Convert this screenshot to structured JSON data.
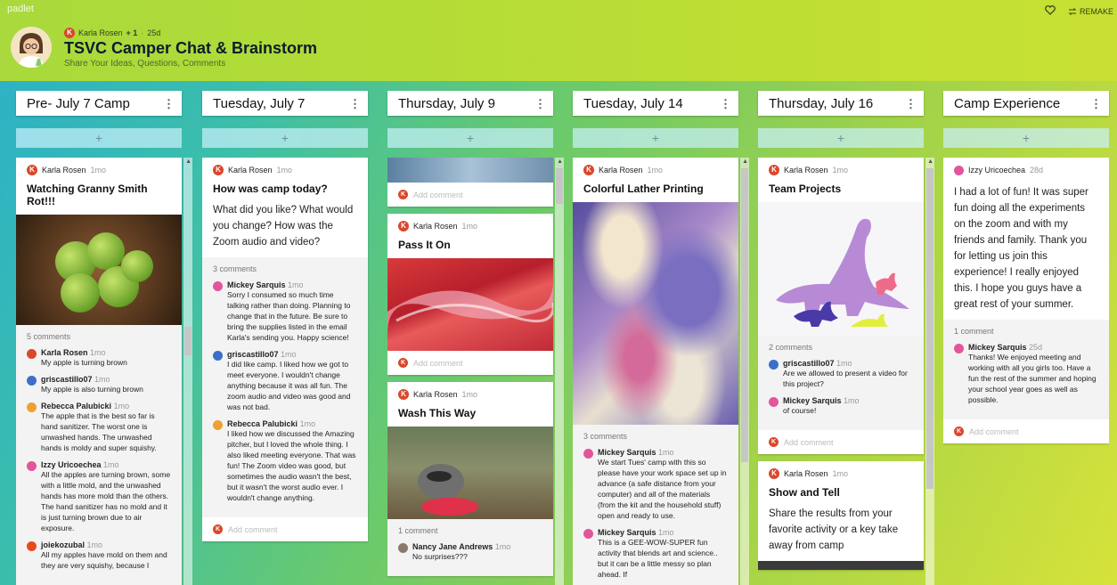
{
  "app": {
    "brand": "padlet",
    "remake_label": "REMAKE"
  },
  "board": {
    "author": "Karla Rosen",
    "plus_count": "+ 1",
    "age": "25d",
    "title": "TSVC Camper Chat & Brainstorm",
    "subtitle": "Share Your Ideas, Questions, Comments"
  },
  "icons": {
    "like": "heart-icon",
    "remake": "remake-icon",
    "more": "kebab-icon",
    "add": "plus-icon"
  },
  "colors": {
    "author_dot": "#d9482b",
    "add_bar": "#c8f0fa"
  },
  "add_symbol": "+",
  "columns": [
    {
      "title": "Pre- July 7 Camp",
      "cards": [
        {
          "author": "Karla Rosen",
          "time": "1mo",
          "title": "Watching Granny Smith Rot!!!",
          "comment_count": "5 comments",
          "comments": [
            {
              "author": "Karla Rosen",
              "time": "1mo",
              "text": "My apple is turning brown"
            },
            {
              "author": "griscastillo07",
              "time": "1mo",
              "text": "My apple is also turning brown"
            },
            {
              "author": "Rebecca Palubicki",
              "time": "1mo",
              "text": "The apple that is the best so far is hand sanitizer. The worst one is unwashed hands. The unwashed hands is moldy and super squishy."
            },
            {
              "author": "Izzy Uricoechea",
              "time": "1mo",
              "text": "All the apples are turning brown, some with a little mold, and the unwashed hands has more mold than the others. The hand sanitizer has no mold and it is just turning brown due to air exposure."
            },
            {
              "author": "joiekozubal",
              "time": "1mo",
              "text": "All my apples have mold on them and they are very squishy, because I"
            }
          ]
        }
      ]
    },
    {
      "title": "Tuesday, July 7",
      "cards": [
        {
          "author": "Karla Rosen",
          "time": "1mo",
          "title": "How was camp today?",
          "body": "What did you like? What would you change? How was the Zoom audio and video?",
          "comment_count": "3 comments",
          "comments": [
            {
              "author": "Mickey Sarquis",
              "time": "1mo",
              "text": "Sorry I consumed so much time talking rather than doing. Planning to change that in the future. Be sure to bring the supplies listed in the email Karla's sending you. Happy science!"
            },
            {
              "author": "griscastillo07",
              "time": "1mo",
              "text": "I did like camp. I liked how we got to meet everyone. I wouldn't change anything because it was all fun. The zoom audio and video was good and was not bad."
            },
            {
              "author": "Rebecca Palubicki",
              "time": "1mo",
              "text": "I liked how we discussed the Amazing pitcher, but I loved the whole thing. I also liked meeting everyone. That was fun! The Zoom video was good, but sometimes the audio wasn't the best, but it wasn't the worst audio ever. I wouldn't change anything."
            }
          ],
          "add_comment": "Add comment"
        }
      ]
    },
    {
      "title": "Thursday, July 9",
      "cards": [
        {
          "add_comment": "Add comment"
        },
        {
          "author": "Karla Rosen",
          "time": "1mo",
          "title": "Pass It On",
          "add_comment": "Add comment"
        },
        {
          "author": "Karla Rosen",
          "time": "1mo",
          "title": "Wash This Way",
          "comment_count": "1 comment",
          "comments": [
            {
              "author": "Nancy Jane Andrews",
              "time": "1mo",
              "text": "No surprises???"
            }
          ]
        }
      ]
    },
    {
      "title": "Tuesday, July 14",
      "cards": [
        {
          "author": "Karla Rosen",
          "time": "1mo",
          "title": "Colorful Lather Printing",
          "comment_count": "3 comments",
          "comments": [
            {
              "author": "Mickey Sarquis",
              "time": "1mo",
              "text": "We start Tues' camp with this so please have your work space set up in advance (a safe distance from your computer) and all of the materials (from the kit and the household stuff) open and ready to use."
            },
            {
              "author": "Mickey Sarquis",
              "time": "1mo",
              "text": "This is a GEE-WOW-SUPER fun activity that blends art and science.. but it can be a little messy so plan ahead. If"
            }
          ]
        }
      ]
    },
    {
      "title": "Thursday, July 16",
      "cards": [
        {
          "author": "Karla Rosen",
          "time": "1mo",
          "title": "Team Projects",
          "comment_count": "2 comments",
          "comments": [
            {
              "author": "griscastillo07",
              "time": "1mo",
              "text": "Are we allowed to present a video for this project?"
            },
            {
              "author": "Mickey Sarquis",
              "time": "1mo",
              "text": "of course!"
            }
          ],
          "add_comment": "Add comment"
        },
        {
          "author": "Karla Rosen",
          "time": "1mo",
          "title": "Show and Tell",
          "body": "Share the results from your favorite activity or a key take away from camp"
        }
      ]
    },
    {
      "title": "Camp Experience",
      "cards": [
        {
          "author": "Izzy Uricoechea",
          "time": "28d",
          "body": "I had a lot of fun! It was super fun doing all the experiments on the zoom and with my friends and family. Thank you for letting us join this experience! I really enjoyed this. I hope you guys have a great rest of your summer.",
          "comment_count": "1 comment",
          "comments": [
            {
              "author": "Mickey Sarquis",
              "time": "25d",
              "text": "Thanks! We enjoyed meeting and working with all you girls too. Have a fun the rest of the summer and hoping your school year goes as well as possible."
            }
          ],
          "add_comment": "Add comment"
        }
      ]
    }
  ]
}
